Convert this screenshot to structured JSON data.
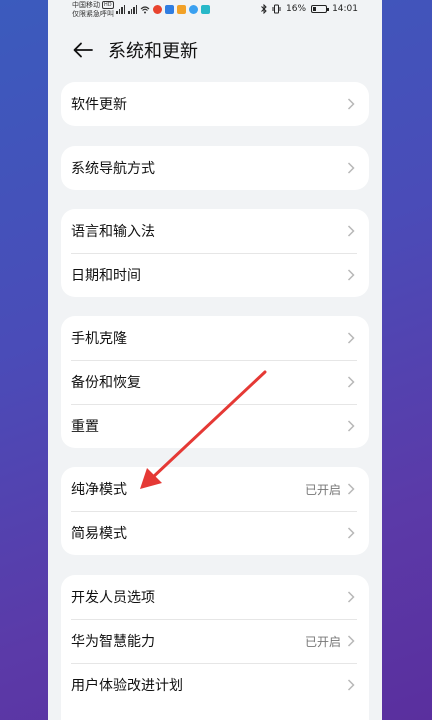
{
  "status_bar": {
    "carrier_line1": "中国移动",
    "carrier_hd": "HD",
    "carrier_line2": "仅限紧急呼叫",
    "battery": "16%",
    "time": "14:01",
    "icons": [
      "signal-icon",
      "signal-icon",
      "wifi-icon",
      "weibo-icon",
      "app-icon",
      "app-icon",
      "app-icon",
      "app-icon",
      "bluetooth-icon",
      "vibrate-icon",
      "battery-icon"
    ]
  },
  "header": {
    "title": "系统和更新"
  },
  "groups": [
    {
      "items": [
        {
          "label": "软件更新",
          "value": ""
        }
      ]
    },
    {
      "items": [
        {
          "label": "系统导航方式",
          "value": ""
        }
      ]
    },
    {
      "items": [
        {
          "label": "语言和输入法",
          "value": ""
        },
        {
          "label": "日期和时间",
          "value": ""
        }
      ]
    },
    {
      "items": [
        {
          "label": "手机克隆",
          "value": ""
        },
        {
          "label": "备份和恢复",
          "value": ""
        },
        {
          "label": "重置",
          "value": ""
        }
      ]
    },
    {
      "items": [
        {
          "label": "纯净模式",
          "value": "已开启"
        },
        {
          "label": "简易模式",
          "value": ""
        }
      ]
    },
    {
      "items": [
        {
          "label": "开发人员选项",
          "value": ""
        },
        {
          "label": "华为智慧能力",
          "value": "已开启"
        },
        {
          "label": "用户体验改进计划",
          "value": ""
        }
      ]
    }
  ],
  "colors": {
    "background_gradient_start": "#3b5bbd",
    "background_gradient_end": "#5a2f9e",
    "annotation_arrow": "#e53935"
  }
}
